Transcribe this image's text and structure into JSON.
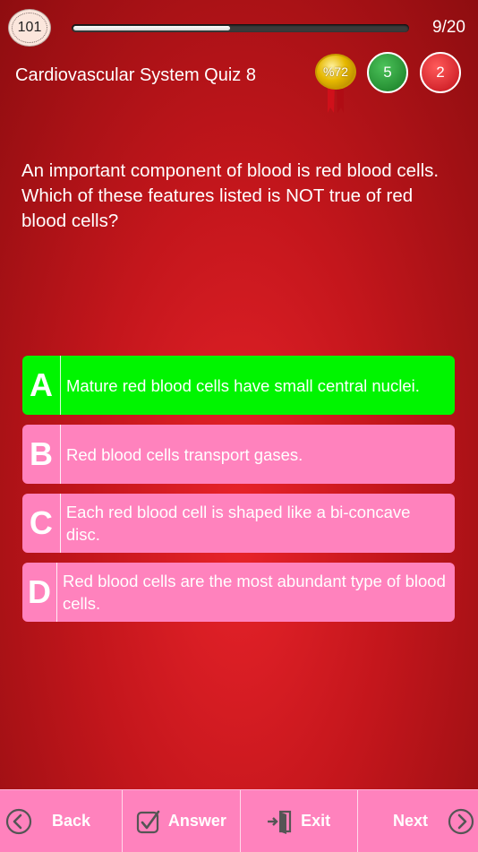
{
  "header": {
    "timer": "101",
    "progress_fraction": 0.47,
    "counter": "9/20",
    "quiz_title": "Cardiovascular System Quiz 8",
    "percent_badge": "%72",
    "correct_count": "5",
    "wrong_count": "2"
  },
  "question": {
    "text": "An important component of blood is red blood cells. Which of these features listed is NOT true of red blood cells?"
  },
  "answers": [
    {
      "letter": "A",
      "text": "Mature red blood cells have small central nuclei.",
      "selected": true
    },
    {
      "letter": "B",
      "text": "Red blood cells transport gases.",
      "selected": false
    },
    {
      "letter": "C",
      "text": "Each red blood cell is shaped like a bi-concave disc.",
      "selected": false
    },
    {
      "letter": "D",
      "text": "Red blood cells are the most abundant type of blood cells.",
      "selected": false
    }
  ],
  "toolbar": {
    "back_label": "Back",
    "answer_label": "Answer",
    "exit_label": "Exit",
    "next_label": "Next"
  },
  "colors": {
    "answer_default": "#ff82bd",
    "answer_selected": "#00f500",
    "background": "#c4161c"
  }
}
